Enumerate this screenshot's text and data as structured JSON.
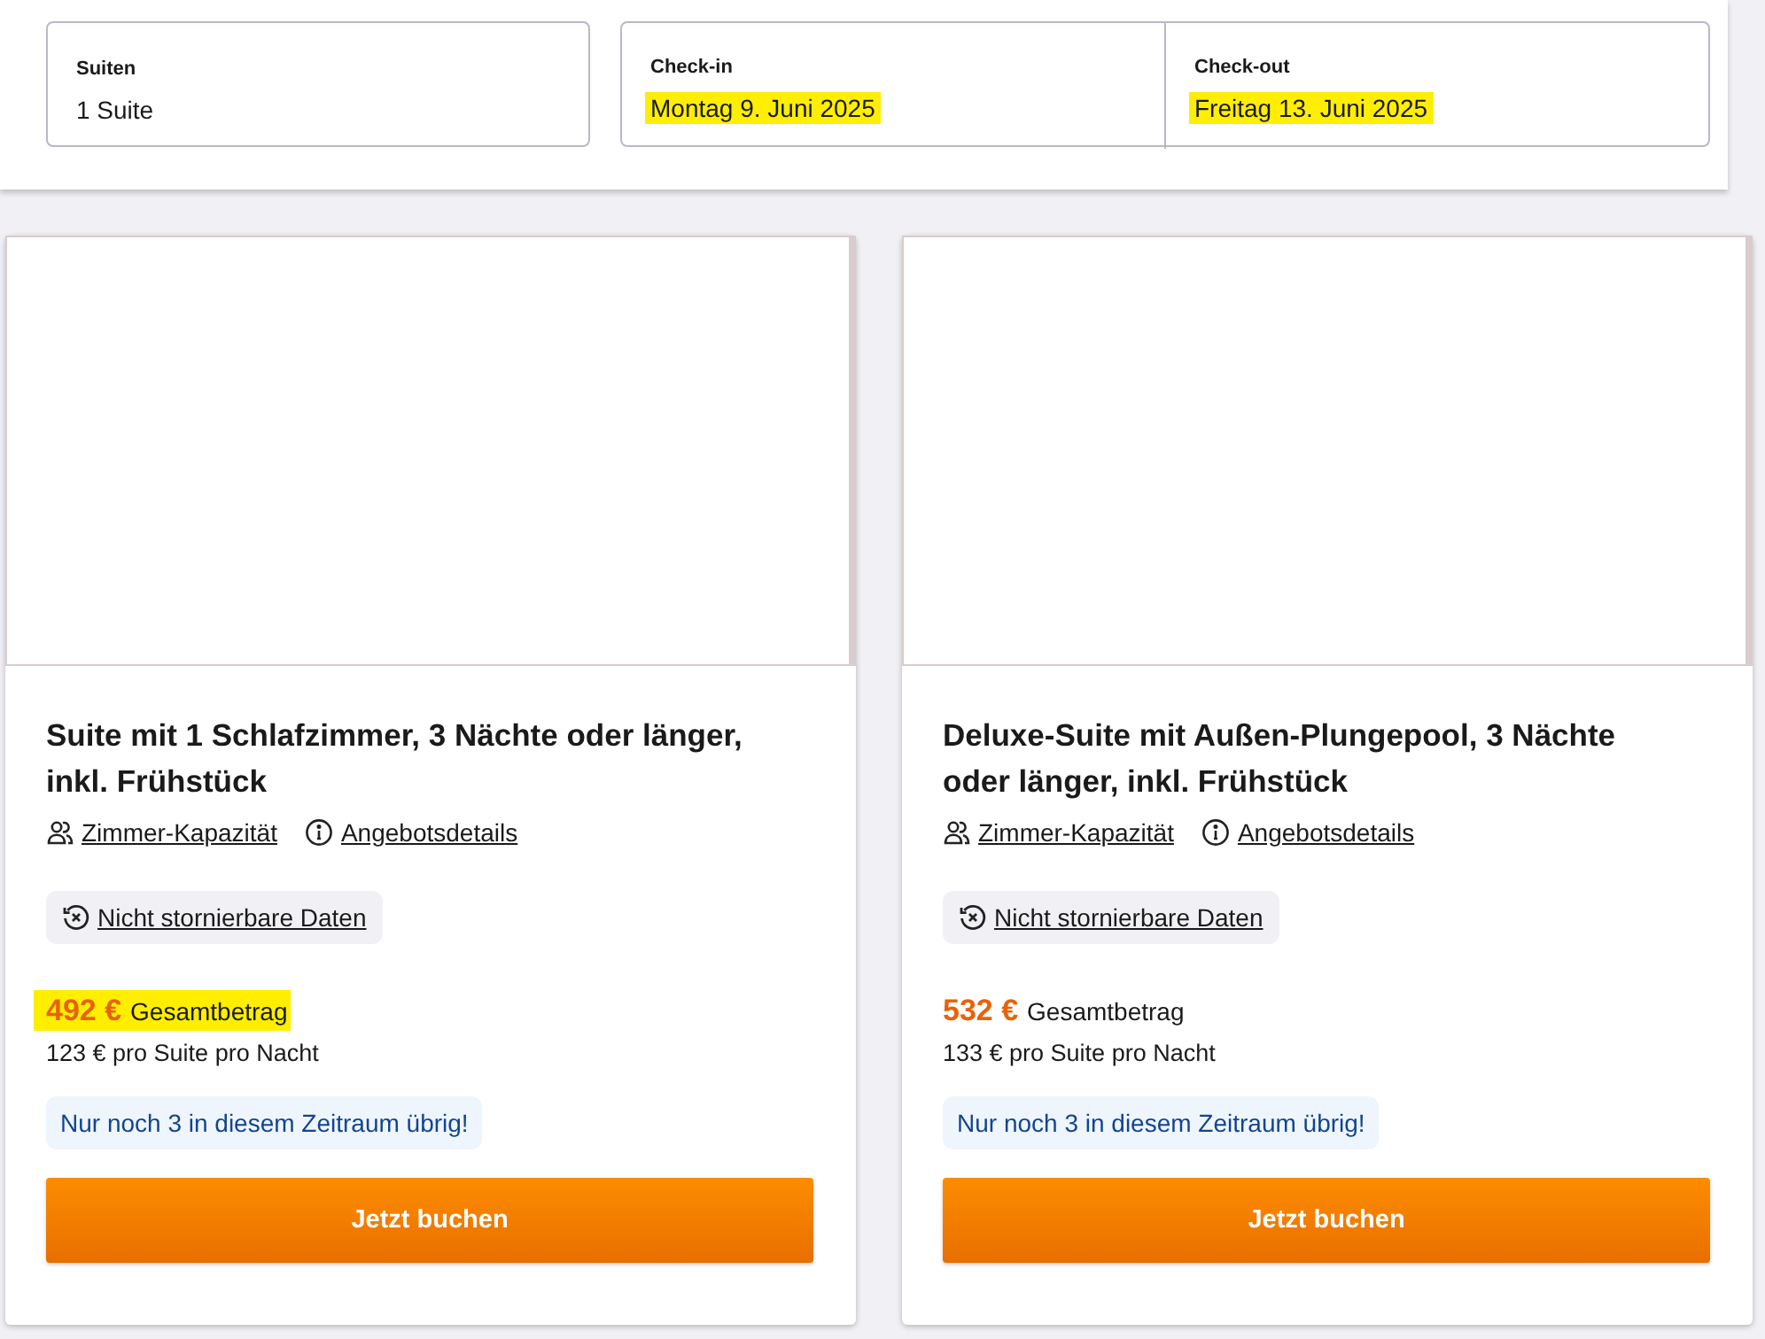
{
  "search": {
    "rooms": {
      "label": "Suiten",
      "value": "1 Suite",
      "highlighted": false
    },
    "checkin": {
      "label": "Check-in",
      "value": "Montag 9. Juni 2025",
      "highlighted": true
    },
    "checkout": {
      "label": "Check-out",
      "value": "Freitag 13. Juni 2025",
      "highlighted": true
    }
  },
  "offers": [
    {
      "title": "Suite mit 1 Schlafzimmer, 3 Nächte oder länger, inkl. Frühstück",
      "capacity_link": "Zimmer-Kapazität",
      "details_link": "Angebotsdetails",
      "cancellation": "Nicht stornierbare Daten",
      "price": "492 €",
      "price_label": "Gesamtbetrag",
      "price_highlighted": true,
      "per_night": "123 € pro Suite pro Nacht",
      "availability": "Nur noch 3 in diesem Zeitraum übrig!",
      "button": "Jetzt buchen"
    },
    {
      "title": "Deluxe-Suite mit Außen-Plungepool, 3 Nächte oder länger, inkl. Frühstück",
      "capacity_link": "Zimmer-Kapazität",
      "details_link": "Angebotsdetails",
      "cancellation": "Nicht stornierbare Daten",
      "price": "532 €",
      "price_label": "Gesamtbetrag",
      "price_highlighted": false,
      "per_night": "133 € pro Suite pro Nacht",
      "availability": "Nur noch 3 in diesem Zeitraum übrig!",
      "button": "Jetzt buchen"
    }
  ]
}
